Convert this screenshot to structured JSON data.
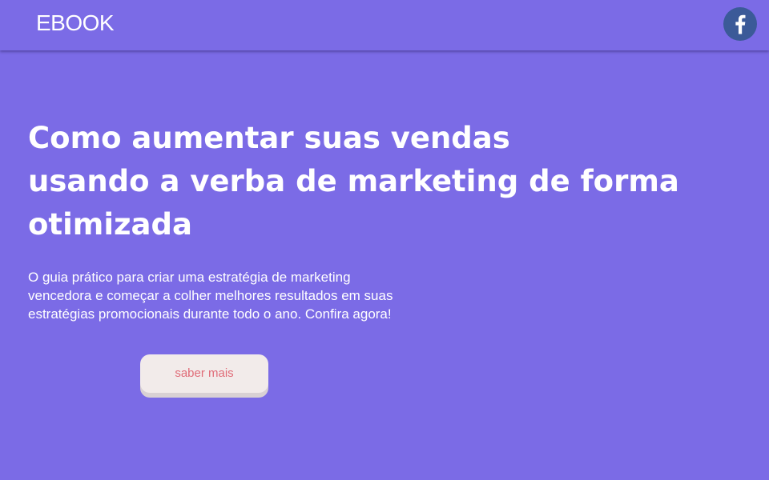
{
  "header": {
    "brand": "EBOOK",
    "social_icon": "facebook-icon",
    "colors": {
      "bar": "#7B6BE6",
      "facebook": "#3B5A98"
    }
  },
  "hero": {
    "headline_lines": [
      "Como aumentar suas vendas",
      "usando a verba de marketing de forma",
      "otimizada"
    ],
    "subtext_lines": [
      "O guia prático para criar uma estratégia de marketing",
      "vencedora e começar a colher melhores resultados em suas",
      "estratégias promocionais durante todo o ano. Confira agora!"
    ],
    "cta_label": "saber mais",
    "colors": {
      "background": "#7B6BE6",
      "cta_text": "#E06C78",
      "cta_bg": "#F2EBEA"
    }
  }
}
